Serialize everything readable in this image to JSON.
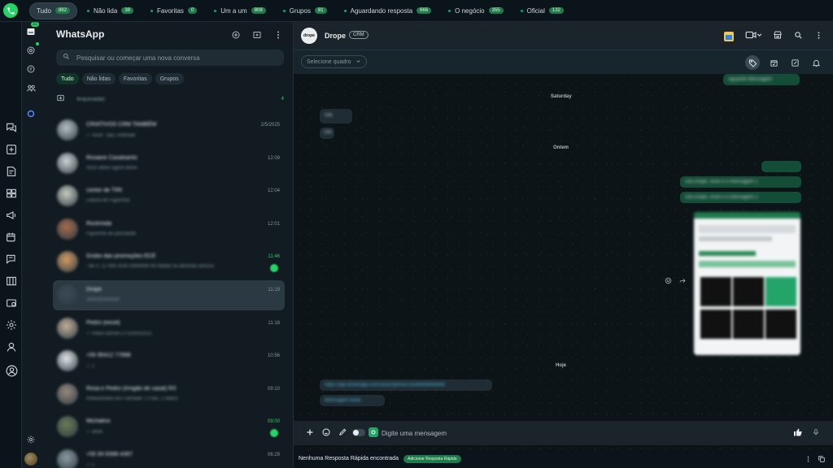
{
  "top_filters": [
    {
      "label": "Tudo",
      "count": "892",
      "active": true
    },
    {
      "label": "Não lida",
      "count": "38"
    },
    {
      "label": "Favoritas",
      "count": "0"
    },
    {
      "label": "Um a um",
      "count": "808"
    },
    {
      "label": "Grupos",
      "count": "81"
    },
    {
      "label": "Aguardando resposta",
      "count": "666"
    },
    {
      "label": "O negócio",
      "count": "355"
    },
    {
      "label": "Oficial",
      "count": "132"
    }
  ],
  "rail_badge": "31",
  "chatlist": {
    "title": "WhatsApp",
    "search_placeholder": "Pesquisar ou começar uma nova conversa",
    "chips": [
      "Tudo",
      "Não lidas",
      "Favoritas",
      "Grupos"
    ],
    "archived_label": "Arquivadas",
    "archived_count": "4",
    "chats": [
      {
        "name": "CRIATIVOS CRM TAMBÉM",
        "preview": "✓ Você: Tipo, Andrade",
        "time": "2/5/2025",
        "green": false
      },
      {
        "name": "Rosiane Casalsanto",
        "preview": "Você atbox agora deixe",
        "time": "12:09",
        "green": false
      },
      {
        "name": "contor de TIRI",
        "preview": "Leitura de Figurinha",
        "time": "12:04",
        "green": false
      },
      {
        "name": "Rockmida",
        "preview": "Figurinha de parcelado",
        "time": "12:01",
        "green": false
      },
      {
        "name": "Grobo das promoções ECE",
        "preview": "~de 3: 12 999 3000-9999999 99 88888 na abrande denuvo",
        "time": "11:46",
        "green": true,
        "badge": true
      },
      {
        "name": "Drope",
        "preview": "ODDDUISDOO",
        "time": "11:19",
        "green": false,
        "selected": true
      },
      {
        "name": "Pedro (excel)",
        "preview": "✓ Pedro Borret-27/10/00/2021",
        "time": "11:18",
        "green": false
      },
      {
        "name": "+55 95412 77898",
        "preview": "✓ 1",
        "time": "10:56",
        "green": false
      },
      {
        "name": "Rosa e Pedro (Irmgão de casal) R3",
        "preview": "Relacionado em Fachada: 1 Falo, 2 status",
        "time": "09:10",
        "green": false
      },
      {
        "name": "Michalino",
        "preview": "✓ 4444",
        "time": "09:00",
        "green": true,
        "badge": true
      },
      {
        "name": "+55 93 9398-4397",
        "preview": "✓ 1",
        "time": "06:29",
        "green": false
      }
    ]
  },
  "conversation": {
    "avatar_text": "drope",
    "name": "Drope",
    "tag": "CRM",
    "board_placeholder": "Selecione quadro",
    "days": [
      "Saturday",
      "Ontem",
      "Hoje"
    ],
    "blurred_messages": [
      {
        "text": "Aguarde Mensagem"
      },
      {
        "text": "Olá"
      },
      {
        "text": "Olá"
      },
      {
        "text": "Olá Drope, esse é a mensagem 1"
      },
      {
        "text": "Olá Drope, esse é a mensagem 2"
      },
      {
        "text": "https://api.whatsapp.com/send?phone=5599999999999"
      },
      {
        "text": "Mensagem teste"
      }
    ],
    "composer_placeholder": "Digite uma mensagem",
    "footer_text": "Nenhuma Resposta Rápida encontrada",
    "footer_button": "Adicionar Resposta Rápida"
  },
  "colors": {
    "accent": "#25d366",
    "bubble_out": "#144d37",
    "panel": "#111b21"
  }
}
